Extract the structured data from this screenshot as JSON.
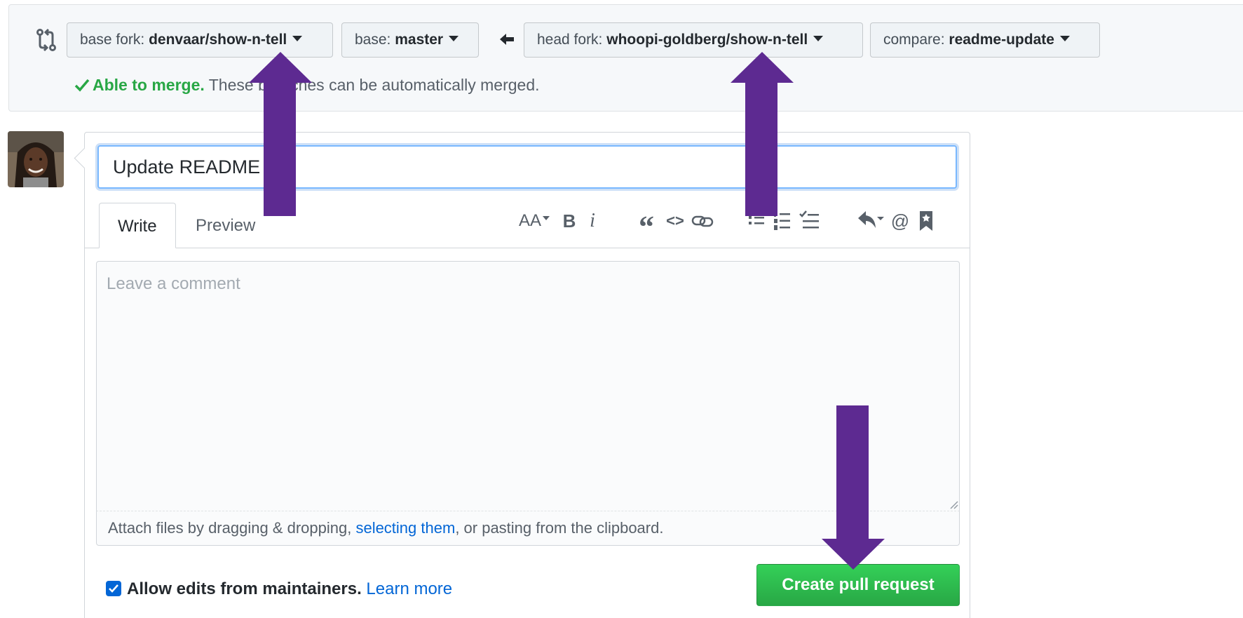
{
  "compare": {
    "base_fork": {
      "label": "base fork:",
      "value": "denvaar/show-n-tell"
    },
    "base": {
      "label": "base:",
      "value": "master"
    },
    "head_fork": {
      "label": "head fork:",
      "value": "whoopi-goldberg/show-n-tell"
    },
    "compare_branch": {
      "label": "compare:",
      "value": "readme-update"
    },
    "merge_status": {
      "ok_text": "Able to merge.",
      "detail_text": "These branches can be automatically merged."
    }
  },
  "form": {
    "title_value": "Update README",
    "tabs": [
      {
        "label": "Write"
      },
      {
        "label": "Preview"
      }
    ],
    "toolbar": {
      "heading": "AA",
      "bold": "B",
      "italic": "i",
      "quote": "“",
      "code": "<>",
      "mention": "@"
    },
    "comment_placeholder": "Leave a comment",
    "attach": {
      "prefix": "Attach files by dragging & dropping, ",
      "link": "selecting them",
      "suffix": ", or pasting from the clipboard."
    },
    "allow_edits": {
      "label": "Allow edits from maintainers.",
      "link": "Learn more",
      "checked": true
    },
    "submit_label": "Create pull request"
  },
  "colors": {
    "annotation_arrow": "#5d2a91",
    "success_green": "#28a745",
    "link_blue": "#0366d6"
  }
}
